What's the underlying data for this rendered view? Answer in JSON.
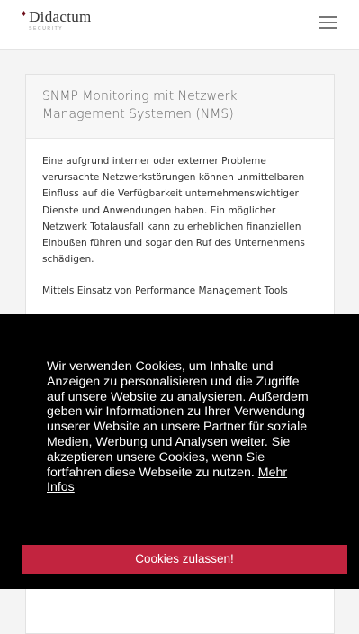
{
  "header": {
    "logo_name": "Didactum",
    "logo_subtitle": "SECURITY",
    "logo_mark": "♦",
    "menu_icon": "hamburger-menu-icon"
  },
  "article": {
    "title": "SNMP Monitoring mit Netzwerk Management Systemen (NMS)",
    "paragraphs": [
      "Eine aufgrund interner oder externer Probleme verursachte Netzwerkstörungen können unmittelbaren Einfluss auf die Verfügbarkeit unternehmenswichtiger Dienste und Anwendungen haben. Ein möglicher Netzwerk Totalausfall kann zu erheblichen finanziellen Einbußen führen und sogar den Ruf des Unternehmens schädigen.",
      "Mittels Einsatz von Performance Management Tools"
    ]
  },
  "cookie_banner": {
    "text": "Wir verwenden Cookies, um Inhalte und Anzeigen zu personalisieren und die Zugriffe auf unsere Website zu analysieren. Außerdem geben wir Informationen zu Ihrer Verwendung unserer Website an unsere Partner für soziale Medien, Werbung und Analysen weiter. Sie akzeptieren unsere Cookies, wenn Sie fortfahren diese Webseite zu nutzen.",
    "link_text": "Mehr Infos",
    "button_label": "Cookies zulassen!",
    "button_color": "#c2243f",
    "background_color": "#000000"
  }
}
